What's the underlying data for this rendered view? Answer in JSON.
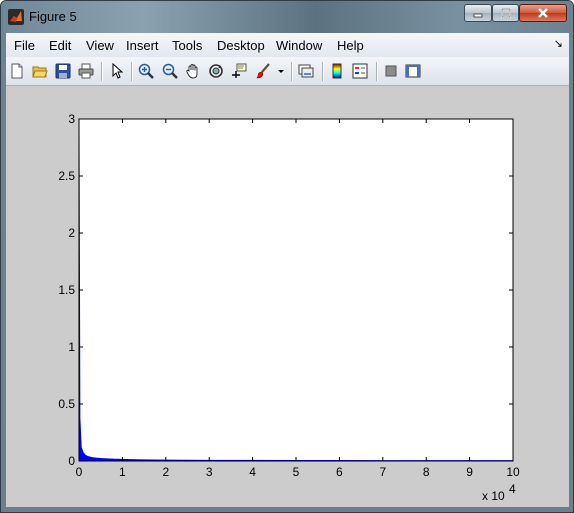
{
  "window": {
    "title": "Figure 5",
    "icon": "matlab-logo-icon",
    "controls": [
      "minimize-icon",
      "maximize-icon",
      "close-icon"
    ]
  },
  "menu": {
    "items": [
      "File",
      "Edit",
      "View",
      "Insert",
      "Tools",
      "Desktop",
      "Window",
      "Help"
    ],
    "dock_glyph": "↘"
  },
  "toolbar": {
    "buttons": [
      "new-figure-icon",
      "open-file-icon",
      "save-icon",
      "print-icon",
      "edit-plot-arrow-icon",
      "zoom-in-icon",
      "zoom-out-icon",
      "pan-hand-icon",
      "rotate-3d-icon",
      "data-cursor-icon",
      "brush-icon",
      "brush-dropdown-icon",
      "link-plot-icon",
      "insert-colorbar-icon",
      "insert-legend-icon",
      "hide-plot-tools-icon",
      "show-plot-tools-icon"
    ]
  },
  "colors": {
    "figure_background": "#cccccc",
    "axes_background": "#ffffff",
    "series": "#0000ff"
  },
  "chart_data": {
    "type": "area",
    "title": "",
    "xlabel": "",
    "ylabel": "",
    "xlim": [
      0,
      100000
    ],
    "ylim": [
      0,
      3
    ],
    "x_ticks": [
      0,
      1,
      2,
      3,
      4,
      5,
      6,
      7,
      8,
      9,
      10
    ],
    "x_tick_labels": [
      "0",
      "1",
      "2",
      "3",
      "4",
      "5",
      "6",
      "7",
      "8",
      "9",
      "10"
    ],
    "x_exponent_label": {
      "base": "x 10",
      "exponent": "4"
    },
    "y_ticks": [
      0,
      0.5,
      1,
      1.5,
      2,
      2.5,
      3
    ],
    "y_tick_labels": [
      "0",
      "0.5",
      "1",
      "1.5",
      "2",
      "2.5",
      "3"
    ],
    "grid": false,
    "legend": "none",
    "series": [
      {
        "x": [
          0,
          200,
          500,
          1000,
          1500,
          2000,
          3000,
          4000,
          5000,
          6000,
          7000,
          8000,
          9000,
          10000,
          12000,
          15000,
          20000,
          30000,
          40000,
          50000,
          60000,
          70000,
          80000,
          90000,
          100000
        ],
        "y": [
          3.0,
          0.38,
          0.12,
          0.07,
          0.05,
          0.04,
          0.03,
          0.025,
          0.022,
          0.02,
          0.018,
          0.016,
          0.015,
          0.014,
          0.012,
          0.01,
          0.008,
          0.006,
          0.005,
          0.004,
          0.004,
          0.003,
          0.003,
          0.003,
          0.003
        ]
      }
    ]
  }
}
